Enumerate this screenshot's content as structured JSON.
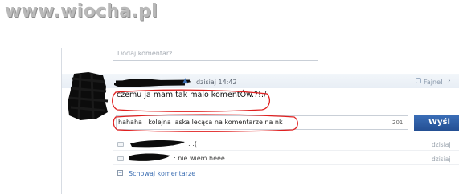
{
  "watermark": "www.wiocha.pl",
  "top_comment_input": {
    "placeholder": "Dodaj komentarz"
  },
  "post": {
    "time": "dzisiaj 14:42",
    "like_label": "Fajne!",
    "text": "czemu ja mam tak malo komentÓw.?!:/"
  },
  "reply": {
    "value": "hahaha i kolejna laska lecąca na komentarze na nk",
    "char_count": "201",
    "send_label": "Wyśl"
  },
  "comments": [
    {
      "text": ": :(",
      "date": "dzisiaj"
    },
    {
      "text": ": nie wiem heee",
      "date": "dzisiaj"
    }
  ],
  "collapse_label": "Schowaj komentarze",
  "colors": {
    "accent": "#3d6fb3",
    "annotation_red": "#e02020",
    "scribble": "#0a0a0a"
  },
  "icons": {
    "like": "thumbs-up-icon",
    "comment": "comment-bubble-icon",
    "collapse": "collapse-icon"
  }
}
